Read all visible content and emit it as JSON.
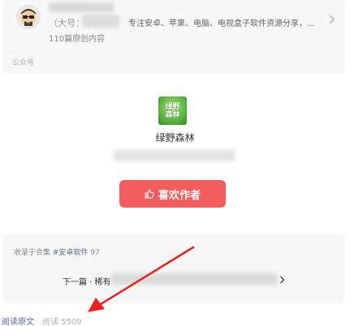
{
  "account": {
    "alias": "（大号：小",
    "description": "专注安卓、苹果、电脑、电视盒子软件资源分享，...",
    "original_count": "110篇原创内容",
    "type_label": "公众号"
  },
  "mini_program": {
    "logo_text": "绿野\n森林",
    "name": "绿野森林"
  },
  "like_button": {
    "label": "喜欢作者",
    "icon": "thumb-up-icon"
  },
  "collection": {
    "prefix": "收录于合集",
    "tag": "#安卓软件",
    "count": "97",
    "next_prefix": "下一篇 · 稀有"
  },
  "footer": {
    "read_original": "阅读原文",
    "read_count": "阅读 5509"
  },
  "colors": {
    "accent_red": "#f25d5d",
    "link_blue": "#576b95",
    "annotation_red": "#e8231f"
  }
}
